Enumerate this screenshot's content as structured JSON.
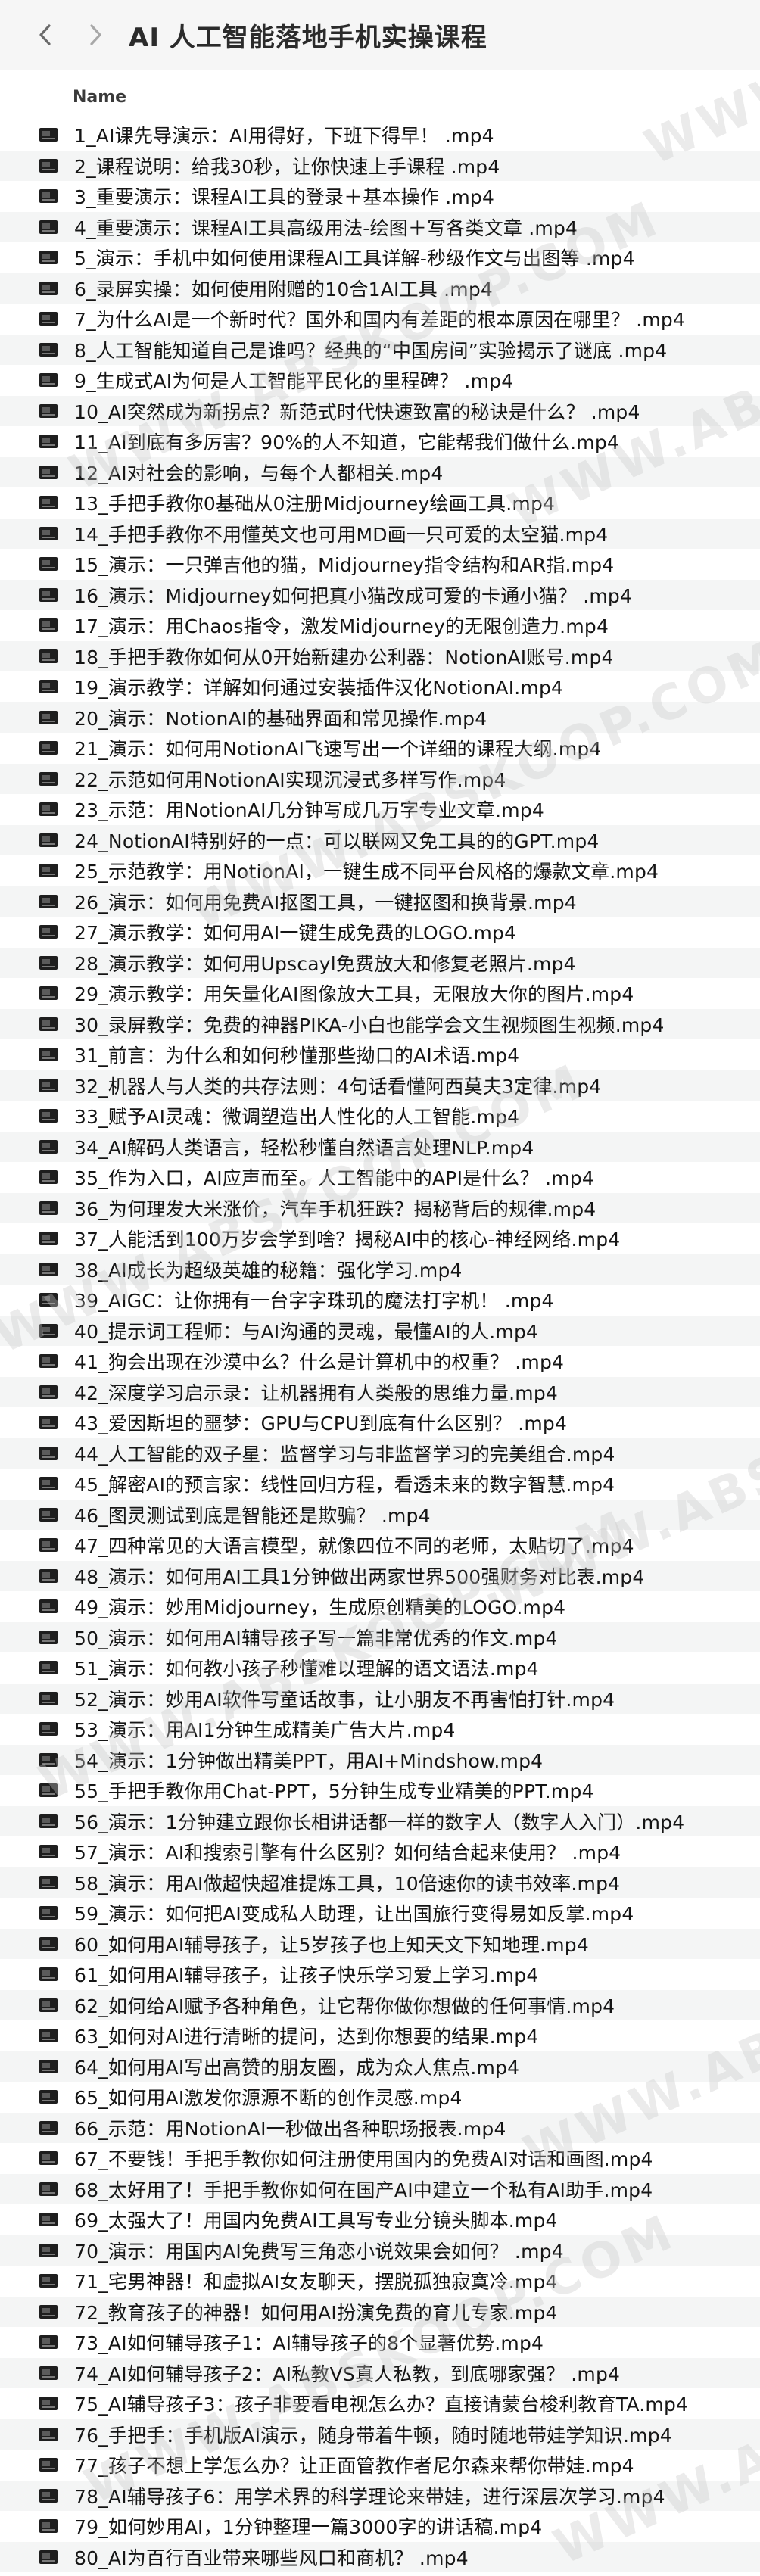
{
  "window": {
    "title": "AI 人工智能落地手机实操课程",
    "back_icon": "chevron-left-icon",
    "forward_icon": "chevron-right-icon"
  },
  "columns": {
    "name": "Name"
  },
  "files": [
    "1_AI课先导演示：AI用得好，下班下得早！ .mp4",
    "2_课程说明：给我30秒，让你快速上手课程 .mp4",
    "3_重要演示：课程AI工具的登录＋基本操作 .mp4",
    "4_重要演示：课程AI工具高级用法-绘图＋写各类文章 .mp4",
    "5_演示：手机中如何使用课程AI工具详解-秒级作文与出图等 .mp4",
    "6_录屏实操：如何使用附赠的10合1AI工具 .mp4",
    "7_为什么AI是一个新时代？国外和国内有差距的根本原因在哪里？ .mp4",
    "8_人工智能知道自己是谁吗？经典的“中国房间”实验揭示了谜底 .mp4",
    "9_生成式AI为何是人工智能平民化的里程碑？ .mp4",
    "10_AI突然成为新拐点？新范式时代快速致富的秘诀是什么？ .mp4",
    "11_AI到底有多厉害？90%的人不知道，它能帮我们做什么.mp4",
    "12_AI对社会的影响，与每个人都相关.mp4",
    "13_手把手教你0基础从0注册Midjourney绘画工具.mp4",
    "14_手把手教你不用懂英文也可用MD画一只可爱的太空猫.mp4",
    "15_演示：一只弹吉他的猫，Midjourney指令结构和AR指.mp4",
    "16_演示：Midjourney如何把真小猫改成可爱的卡通小猫？ .mp4",
    "17_演示：用Chaos指令，激发Midjourney的无限创造力.mp4",
    "18_手把手教你如何从0开始新建办公利器：NotionAI账号.mp4",
    "19_演示教学：详解如何通过安装插件汉化NotionAI.mp4",
    "20_演示：NotionAI的基础界面和常见操作.mp4",
    "21_演示：如何用NotionAI飞速写出一个详细的课程大纲.mp4",
    "22_示范如何用NotionAI实现沉浸式多样写作.mp4",
    "23_示范：用NotionAI几分钟写成几万字专业文章.mp4",
    "24_NotionAI特别好的一点：可以联网又免工具的的GPT.mp4",
    "25_示范教学：用NotionAI，一键生成不同平台风格的爆款文章.mp4",
    "26_演示：如何用免费AI抠图工具，一键抠图和换背景.mp4",
    "27_演示教学：如何用AI一键生成免费的LOGO.mp4",
    "28_演示教学：如何用Upscayl免费放大和修复老照片.mp4",
    "29_演示教学：用矢量化AI图像放大工具，无限放大你的图片.mp4",
    "30_录屏教学：免费的神器PIKA-小白也能学会文生视频图生视频.mp4",
    "31_前言：为什么和如何秒懂那些拗口的AI术语.mp4",
    "32_机器人与人类的共存法则：4句话看懂阿西莫夫3定律.mp4",
    "33_赋予AI灵魂：微调塑造出人性化的人工智能.mp4",
    "34_AI解码人类语言，轻松秒懂自然语言处理NLP.mp4",
    "35_作为入口，AI应声而至。人工智能中的API是什么？ .mp4",
    "36_为何理发大米涨价，汽车手机狂跌？揭秘背后的规律.mp4",
    "37_人能活到100万岁会学到啥？揭秘AI中的核心-神经网络.mp4",
    "38_AI成长为超级英雄的秘籍：强化学习.mp4",
    "39_AIGC：让你拥有一台字字珠玑的魔法打字机！ .mp4",
    "40_提示词工程师：与AI沟通的灵魂，最懂AI的人.mp4",
    "41_狗会出现在沙漠中么？什么是计算机中的权重？ .mp4",
    "42_深度学习启示录：让机器拥有人类般的思维力量.mp4",
    "43_爱因斯坦的噩梦：GPU与CPU到底有什么区别？ .mp4",
    "44_人工智能的双子星：监督学习与非监督学习的完美组合.mp4",
    "45_解密AI的预言家：线性回归方程，看透未来的数字智慧.mp4",
    "46_图灵测试到底是智能还是欺骗？ .mp4",
    "47_四种常见的大语言模型，就像四位不同的老师，太贴切了.mp4",
    "48_演示：如何用AI工具1分钟做出两家世界500强财务对比表.mp4",
    "49_演示：妙用Midjourney，生成原创精美的LOGO.mp4",
    "50_演示：如何用AI辅导孩子写一篇非常优秀的作文.mp4",
    "51_演示：如何教小孩子秒懂难以理解的语文语法.mp4",
    "52_演示：妙用AI软件写童话故事，让小朋友不再害怕打针.mp4",
    "53_演示：用AI1分钟生成精美广告大片.mp4",
    "54_演示：1分钟做出精美PPT，用AI+Mindshow.mp4",
    "55_手把手教你用Chat-PPT，5分钟生成专业精美的PPT.mp4",
    "56_演示：1分钟建立跟你长相讲话都一样的数字人（数字人入门）.mp4",
    "57_演示：AI和搜索引擎有什么区别？如何结合起来使用？ .mp4",
    "58_演示：用AI做超快超准提炼工具，10倍速你的读书效率.mp4",
    "59_演示：如何把AI变成私人助理，让出国旅行变得易如反掌.mp4",
    "60_如何用AI辅导孩子，让5岁孩子也上知天文下知地理.mp4",
    "61_如何用AI辅导孩子，让孩子快乐学习爱上学习.mp4",
    "62_如何给AI赋予各种角色，让它帮你做你想做的任何事情.mp4",
    "63_如何对AI进行清晰的提问，达到你想要的结果.mp4",
    "64_如何用AI写出高赞的朋友圈，成为众人焦点.mp4",
    "65_如何用AI激发你源源不断的创作灵感.mp4",
    "66_示范：用NotionAI一秒做出各种职场报表.mp4",
    "67_不要钱！手把手教你如何注册使用国内的免费AI对话和画图.mp4",
    "68_太好用了！手把手教你如何在国产AI中建立一个私有AI助手.mp4",
    "69_太强大了！用国内免费AI工具写专业分镜头脚本.mp4",
    "70_演示：用国内AI免费写三角恋小说效果会如何？ .mp4",
    "71_宅男神器！和虚拟AI女友聊天，摆脱孤独寂寞冷.mp4",
    "72_教育孩子的神器！如何用AI扮演免费的育儿专家.mp4",
    "73_AI如何辅导孩子1：AI辅导孩子的8个显著优势.mp4",
    "74_AI如何辅导孩子2：AI私教VS真人私教，到底哪家强？ .mp4",
    "75_AI辅导孩子3：孩子非要看电视怎么办？直接请蒙台梭利教育TA.mp4",
    "76_手把手：手机版AI演示，随身带着牛顿，随时随地带娃学知识.mp4",
    "77_孩子不想上学怎么办？让正面管教作者尼尔森来帮你带娃.mp4",
    "78_AI辅导孩子6：用学术界的科学理论来带娃，进行深层次学习.mp4",
    "79_如何妙用AI，1分钟整理一篇3000字的讲话稿.mp4",
    "80_AI为百行百业带来哪些风口和商机？ .mp4"
  ],
  "file_icon": "video-file-icon",
  "watermark": "WWW.ABSKOOP.COM"
}
